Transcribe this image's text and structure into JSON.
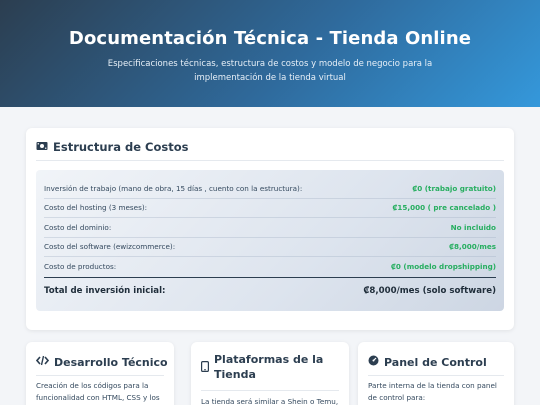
{
  "header": {
    "title": "Documentación Técnica - Tienda Online",
    "subtitle": "Especificaciones técnicas, estructura de costos y modelo de negocio para la implementación de la tienda virtual"
  },
  "costs": {
    "icon": "money-icon",
    "title": "Estructura de Costos",
    "rows": [
      {
        "label": "Inversión de trabajo (mano de obra, 15 días , cuento con la estructura):",
        "value": "₡0 (trabajo gratuito)"
      },
      {
        "label": "Costo del hosting (3 meses):",
        "value": "₡15,000 ( pre cancelado )"
      },
      {
        "label": "Costo del dominio:",
        "value": "No incluido"
      },
      {
        "label": "Costo del software (ewizcommerce):",
        "value": "₡8,000/mes"
      },
      {
        "label": "Costo de productos:",
        "value": "₡0 (modelo dropshipping)"
      }
    ],
    "total": {
      "label": "Total de inversión inicial:",
      "value": "₡8,000/mes (solo software)"
    }
  },
  "cards": [
    {
      "icon": "code-icon",
      "title": "Desarrollo Técnico",
      "text": "Creación de los códigos para la funcionalidad con HTML, CSS y los"
    },
    {
      "icon": "mobile-icon",
      "title_line1": "Plataformas de la",
      "title_line2": "Tienda",
      "text": "La tienda será similar a Shein o Temu,"
    },
    {
      "icon": "dashboard-icon",
      "title": "Panel de Control",
      "text": "Parte interna de la tienda con panel de control para:"
    }
  ],
  "colors": {
    "accent": "#3498db",
    "dark": "#2c3e50",
    "positive": "#27ae60"
  }
}
